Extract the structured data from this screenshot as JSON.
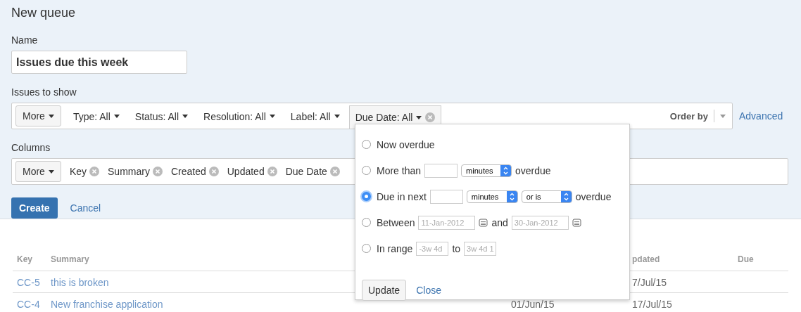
{
  "title": "New queue",
  "name_field": {
    "label": "Name",
    "value": "Issues due this week"
  },
  "filters": {
    "label": "Issues to show",
    "more": "More",
    "items": [
      {
        "label": "Type: All",
        "active": false
      },
      {
        "label": "Status: All",
        "active": false
      },
      {
        "label": "Resolution: All",
        "active": false
      },
      {
        "label": "Label: All",
        "active": false
      },
      {
        "label": "Due Date: All",
        "active": true
      }
    ],
    "order_by": "Order by",
    "advanced": "Advanced"
  },
  "columns": {
    "label": "Columns",
    "more": "More",
    "items": [
      "Key",
      "Summary",
      "Created",
      "Updated",
      "Due Date"
    ]
  },
  "actions": {
    "create": "Create",
    "cancel": "Cancel"
  },
  "table": {
    "columns": [
      "Key",
      "Summary",
      null,
      "pdated",
      "Due"
    ],
    "rows": [
      [
        "CC-5",
        "this is broken",
        null,
        "7/Jul/15",
        null
      ],
      [
        "CC-4",
        "New franchise application",
        "01/Jun/15",
        "17/Jul/15",
        null
      ]
    ]
  },
  "popup": {
    "options": [
      {
        "kind": "plain",
        "selected": false,
        "parts": [
          "Now overdue"
        ]
      },
      {
        "kind": "more",
        "selected": false,
        "parts": [
          "More than",
          "minutes",
          "overdue"
        ]
      },
      {
        "kind": "next",
        "selected": true,
        "parts": [
          "Due in next",
          "minutes",
          "or is",
          "overdue"
        ]
      },
      {
        "kind": "between",
        "selected": false,
        "parts": [
          "Between",
          "11-Jan-2012",
          "and",
          "30-Jan-2012"
        ]
      },
      {
        "kind": "range",
        "selected": false,
        "parts": [
          "In range",
          "-3w 4d",
          "to",
          "3w 4d 1"
        ]
      }
    ],
    "update": "Update",
    "close": "Close"
  }
}
